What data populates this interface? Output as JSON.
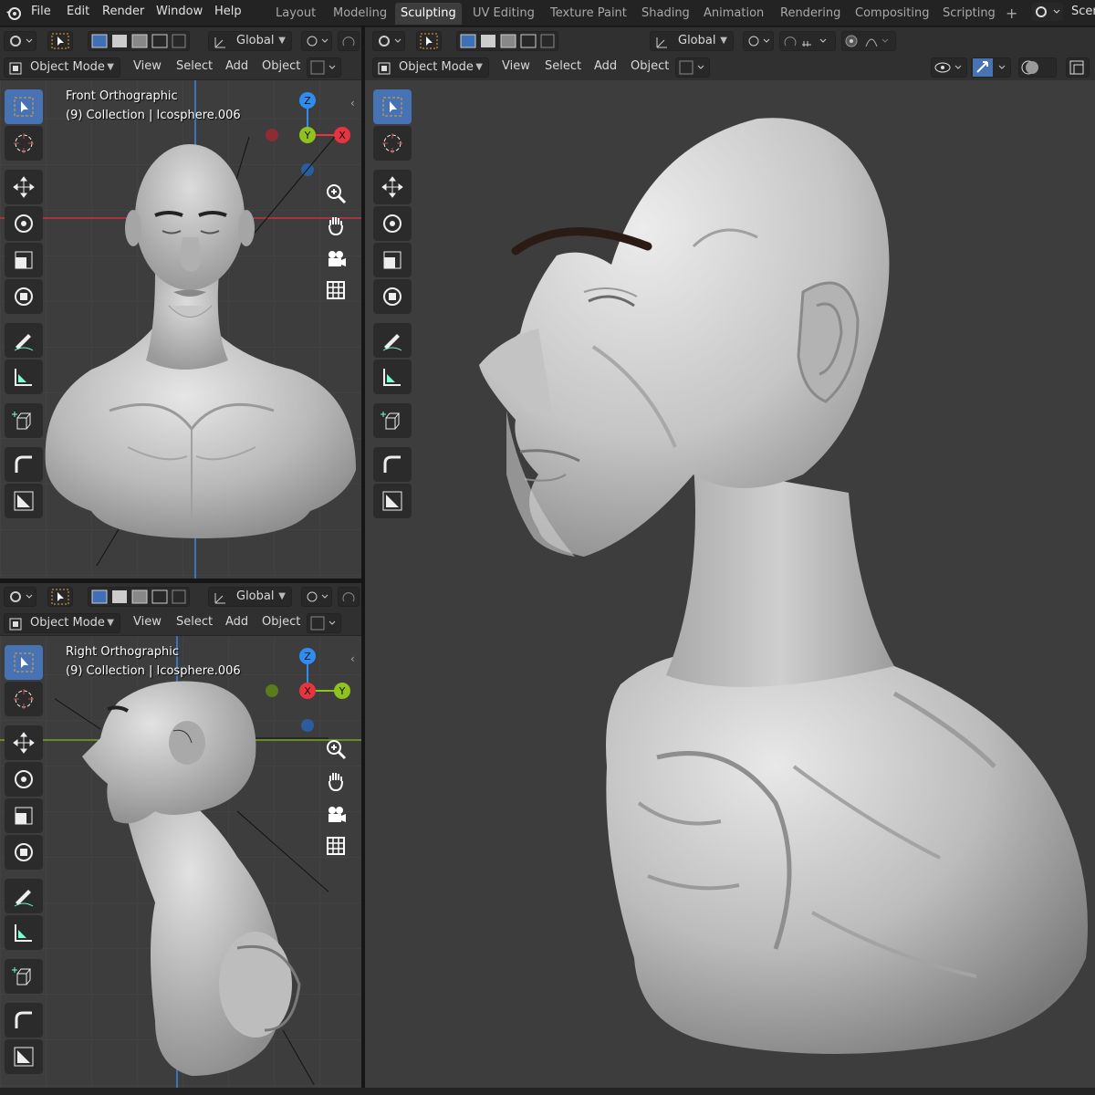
{
  "menu": [
    "File",
    "Edit",
    "Render",
    "Window",
    "Help"
  ],
  "workspaces": [
    {
      "label": "Layout",
      "active": false
    },
    {
      "label": "Modeling",
      "active": false
    },
    {
      "label": "Sculpting",
      "active": true
    },
    {
      "label": "UV Editing",
      "active": false
    },
    {
      "label": "Texture Paint",
      "active": false
    },
    {
      "label": "Shading",
      "active": false
    },
    {
      "label": "Animation",
      "active": false
    },
    {
      "label": "Rendering",
      "active": false
    },
    {
      "label": "Compositing",
      "active": false
    },
    {
      "label": "Scripting",
      "active": false
    }
  ],
  "scene_label": "Scen",
  "header": {
    "orientation": "Global",
    "mode": "Object Mode",
    "view": "View",
    "select": "Select",
    "add": "Add",
    "object": "Object"
  },
  "viewports": {
    "front": {
      "title": "Front Orthographic",
      "subtitle": "(9) Collection | Icosphere.006"
    },
    "right": {
      "title": "Right Orthographic",
      "subtitle": "(9) Collection | Icosphere.006"
    }
  },
  "gizmo": {
    "z": "Z",
    "y": "Y",
    "x": "X"
  },
  "colors": {
    "active_tool": "#4772b3",
    "axis_x": "#e8343f",
    "axis_y": "#8fc21f",
    "axis_z": "#2f8cf0"
  },
  "tools": [
    "select-box-icon",
    "cursor-icon",
    "move-icon",
    "rotate-icon",
    "scale-icon",
    "transform-icon",
    "annotate-icon",
    "measure-icon",
    "add-cube-icon",
    "bevel-icon",
    "shrink-icon"
  ]
}
